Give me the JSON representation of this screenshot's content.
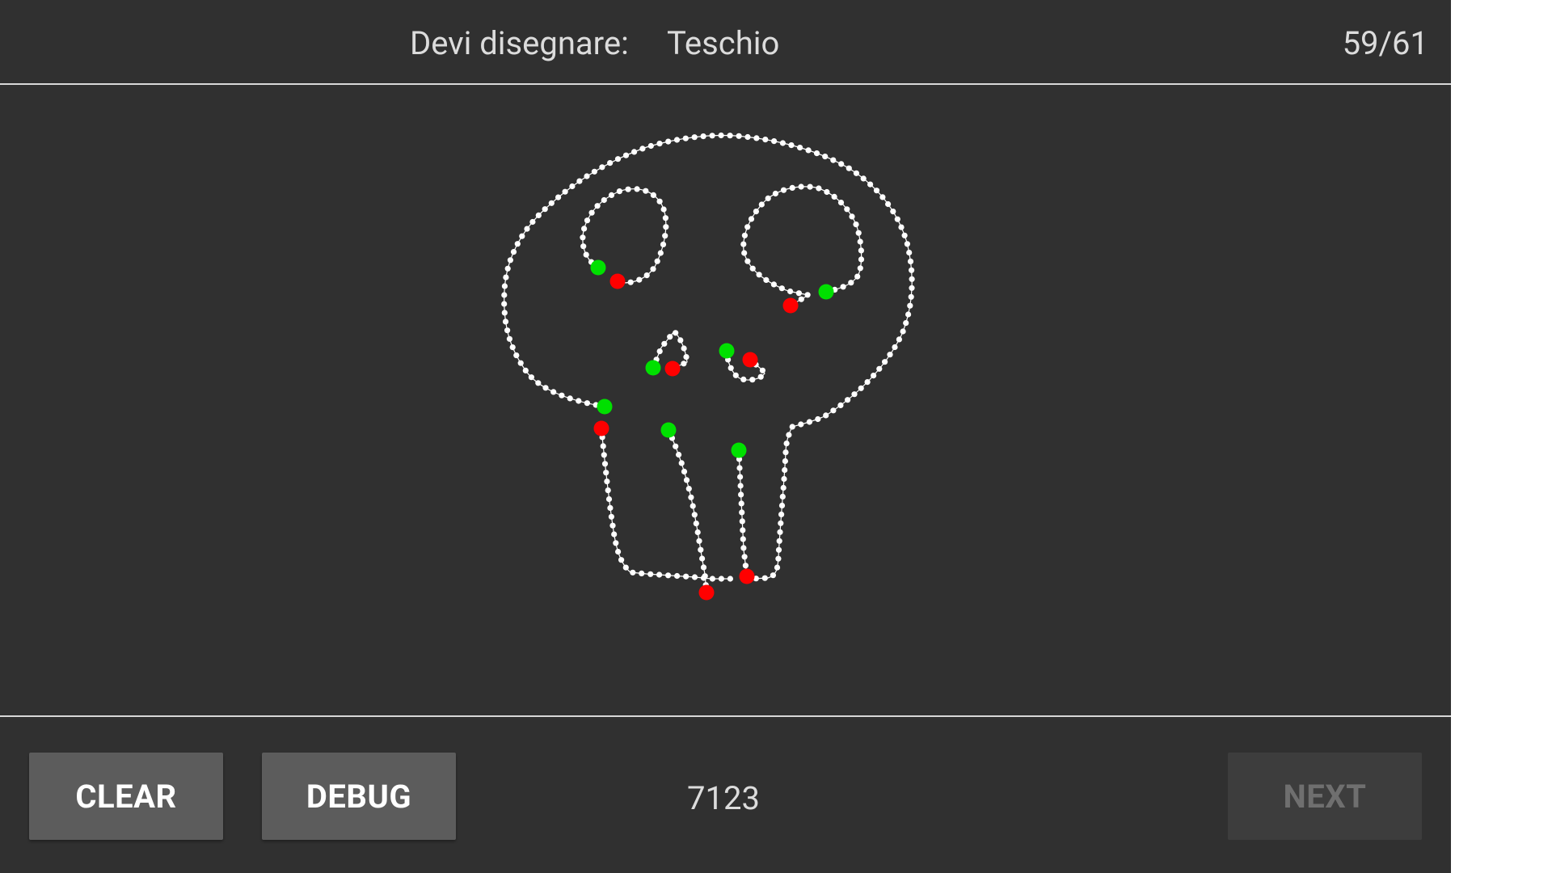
{
  "header": {
    "prompt_label": "Devi disegnare:",
    "prompt_word": "Teschio",
    "counter": "59/61"
  },
  "footer": {
    "clear_label": "CLEAR",
    "debug_label": "DEBUG",
    "score": "7123",
    "next_label": "NEXT"
  },
  "colors": {
    "background": "#303030",
    "stroke": "#ffffff",
    "start_marker": "#00e000",
    "end_marker": "#ff0000"
  },
  "drawing": {
    "subject": "skull"
  }
}
